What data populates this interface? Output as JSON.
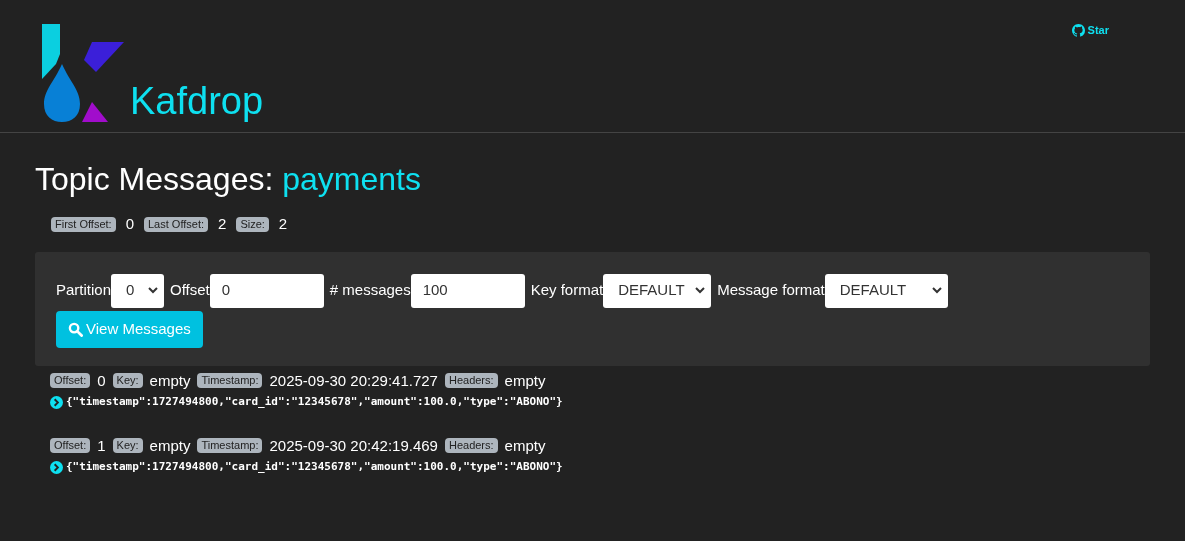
{
  "header": {
    "app_name": "Kafdrop",
    "star_link": "Star"
  },
  "title": {
    "prefix": "Topic Messages:",
    "topic": "payments"
  },
  "stats": [
    {
      "label": "First Offset:",
      "value": "0"
    },
    {
      "label": "Last Offset:",
      "value": "2"
    },
    {
      "label": "Size:",
      "value": "2"
    }
  ],
  "form": {
    "fields": [
      {
        "kind": "select",
        "label": "Partition",
        "value": "0"
      },
      {
        "kind": "input",
        "label": "Offset",
        "value": "0"
      },
      {
        "kind": "input",
        "label": "# messages",
        "value": "100"
      },
      {
        "kind": "select",
        "label": "Key format",
        "value": "DEFAULT"
      },
      {
        "kind": "select",
        "label": "Message format",
        "value": "DEFAULT"
      }
    ],
    "button": "View Messages"
  },
  "messages": [
    {
      "fields": [
        {
          "label": "Offset:",
          "value": "0"
        },
        {
          "label": "Key:",
          "value": "empty"
        },
        {
          "label": "Timestamp:",
          "value": "2025-09-30 20:29:41.727"
        },
        {
          "label": "Headers:",
          "value": "empty"
        }
      ],
      "body": "{\"timestamp\":1727494800,\"card_id\":\"12345678\",\"amount\":100.0,\"type\":\"ABONO\"}"
    },
    {
      "fields": [
        {
          "label": "Offset:",
          "value": "1"
        },
        {
          "label": "Key:",
          "value": "empty"
        },
        {
          "label": "Timestamp:",
          "value": "2025-09-30 20:42:19.469"
        },
        {
          "label": "Headers:",
          "value": "empty"
        }
      ],
      "body": "{\"timestamp\":1727494800,\"card_id\":\"12345678\",\"amount\":100.0,\"type\":\"ABONO\"}"
    }
  ]
}
